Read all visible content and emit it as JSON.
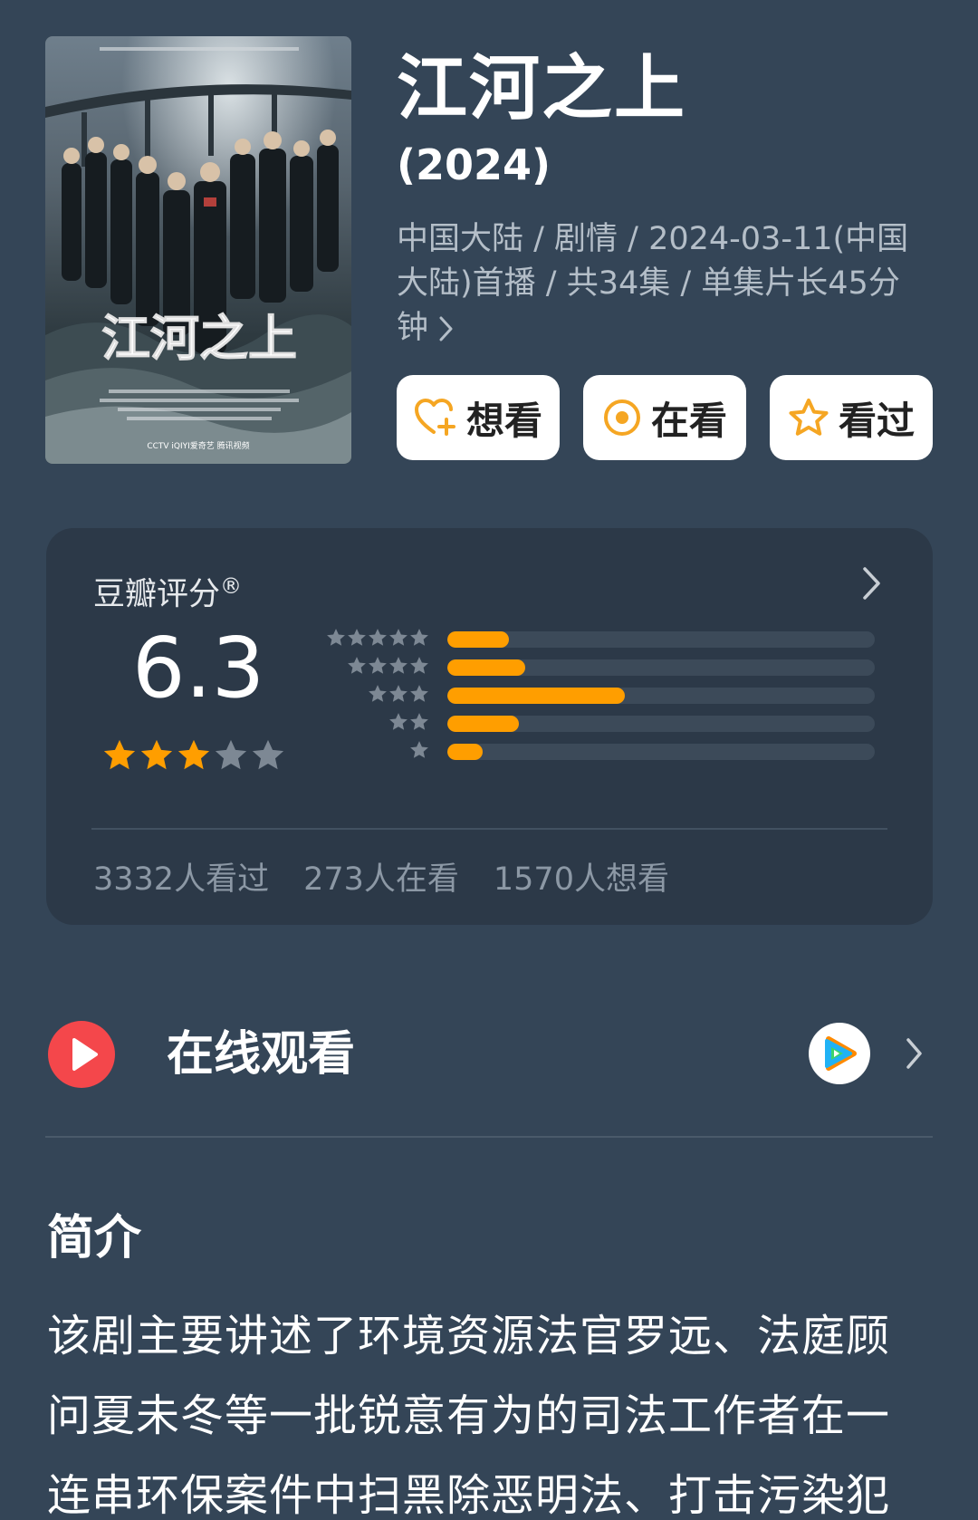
{
  "movie": {
    "title": "江河之上",
    "year": "(2024)",
    "meta_line": "中国大陆 / 剧情 / 2024-03-11(中国大陆)首播 / 共34集 / 单集片长45分钟",
    "meta_more_icon": "chevron-right-icon",
    "poster": {
      "calligraphy_title": "江河之上",
      "broadcasters": "CCTV  iQIYI爱奇艺  腾讯视频"
    }
  },
  "actions": [
    {
      "label": "想看",
      "icon": "heart-plus-icon"
    },
    {
      "label": "在看",
      "icon": "target-circle-icon"
    },
    {
      "label": "看过",
      "icon": "star-outline-icon"
    }
  ],
  "rating": {
    "label": "豆瓣评分",
    "registered_mark": "®",
    "score": "6.3",
    "score_stars": 3,
    "max_stars": 5,
    "distribution": [
      {
        "stars": 5,
        "fraction": 0.145
      },
      {
        "stars": 4,
        "fraction": 0.183
      },
      {
        "stars": 3,
        "fraction": 0.415
      },
      {
        "stars": 2,
        "fraction": 0.168
      },
      {
        "stars": 1,
        "fraction": 0.082
      }
    ],
    "counts": {
      "watched": "3332人看过",
      "watching": "273人在看",
      "want": "1570人想看"
    }
  },
  "watch_online": {
    "label": "在线观看",
    "icon": "play-circle-icon",
    "provider_icon": "tencent-video-icon"
  },
  "intro": {
    "heading": "简介",
    "text": "该剧主要讲述了环境资源法官罗远、法庭顾问夏未冬等一批锐意有为的司法工作者在一连串环保案件中扫黑除恶明法、打击污染犯"
  },
  "colors": {
    "background": "#344557",
    "card": "#2c3948",
    "accent_orange": "#ff9e00",
    "star_gray": "#7d8894",
    "play_red": "#f4474b"
  }
}
